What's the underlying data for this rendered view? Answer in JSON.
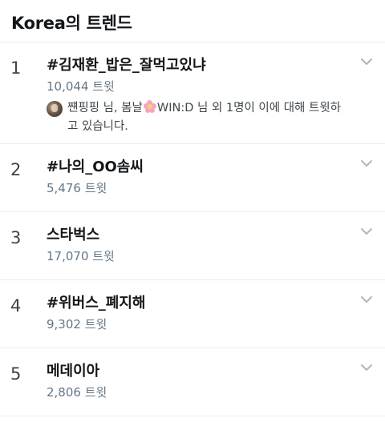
{
  "header": {
    "title": "Korea의 트렌드"
  },
  "icons": {
    "chevron": "chevron-down-icon",
    "context_emoji": "cherry-blossom-icon"
  },
  "colors": {
    "text_primary": "#14171a",
    "text_secondary": "#657786",
    "divider": "#e6ecf0",
    "chevron": "#aab8c2"
  },
  "trends": [
    {
      "rank": "1",
      "name": "#김재환_밥은_잘먹고있냐",
      "count": "10,044 트윗",
      "context": {
        "line_before_emoji": "쨴핑핑 님, 봄날",
        "line_after_emoji": "WIN:D 님 외 1명이 이에 대해 트윗하고 있습니다."
      }
    },
    {
      "rank": "2",
      "name": "#나의_OO솜씨",
      "count": "5,476 트윗"
    },
    {
      "rank": "3",
      "name": "스타벅스",
      "count": "17,070 트윗"
    },
    {
      "rank": "4",
      "name": "#위버스_폐지해",
      "count": "9,302 트윗"
    },
    {
      "rank": "5",
      "name": "메데이아",
      "count": "2,806 트윗"
    }
  ]
}
